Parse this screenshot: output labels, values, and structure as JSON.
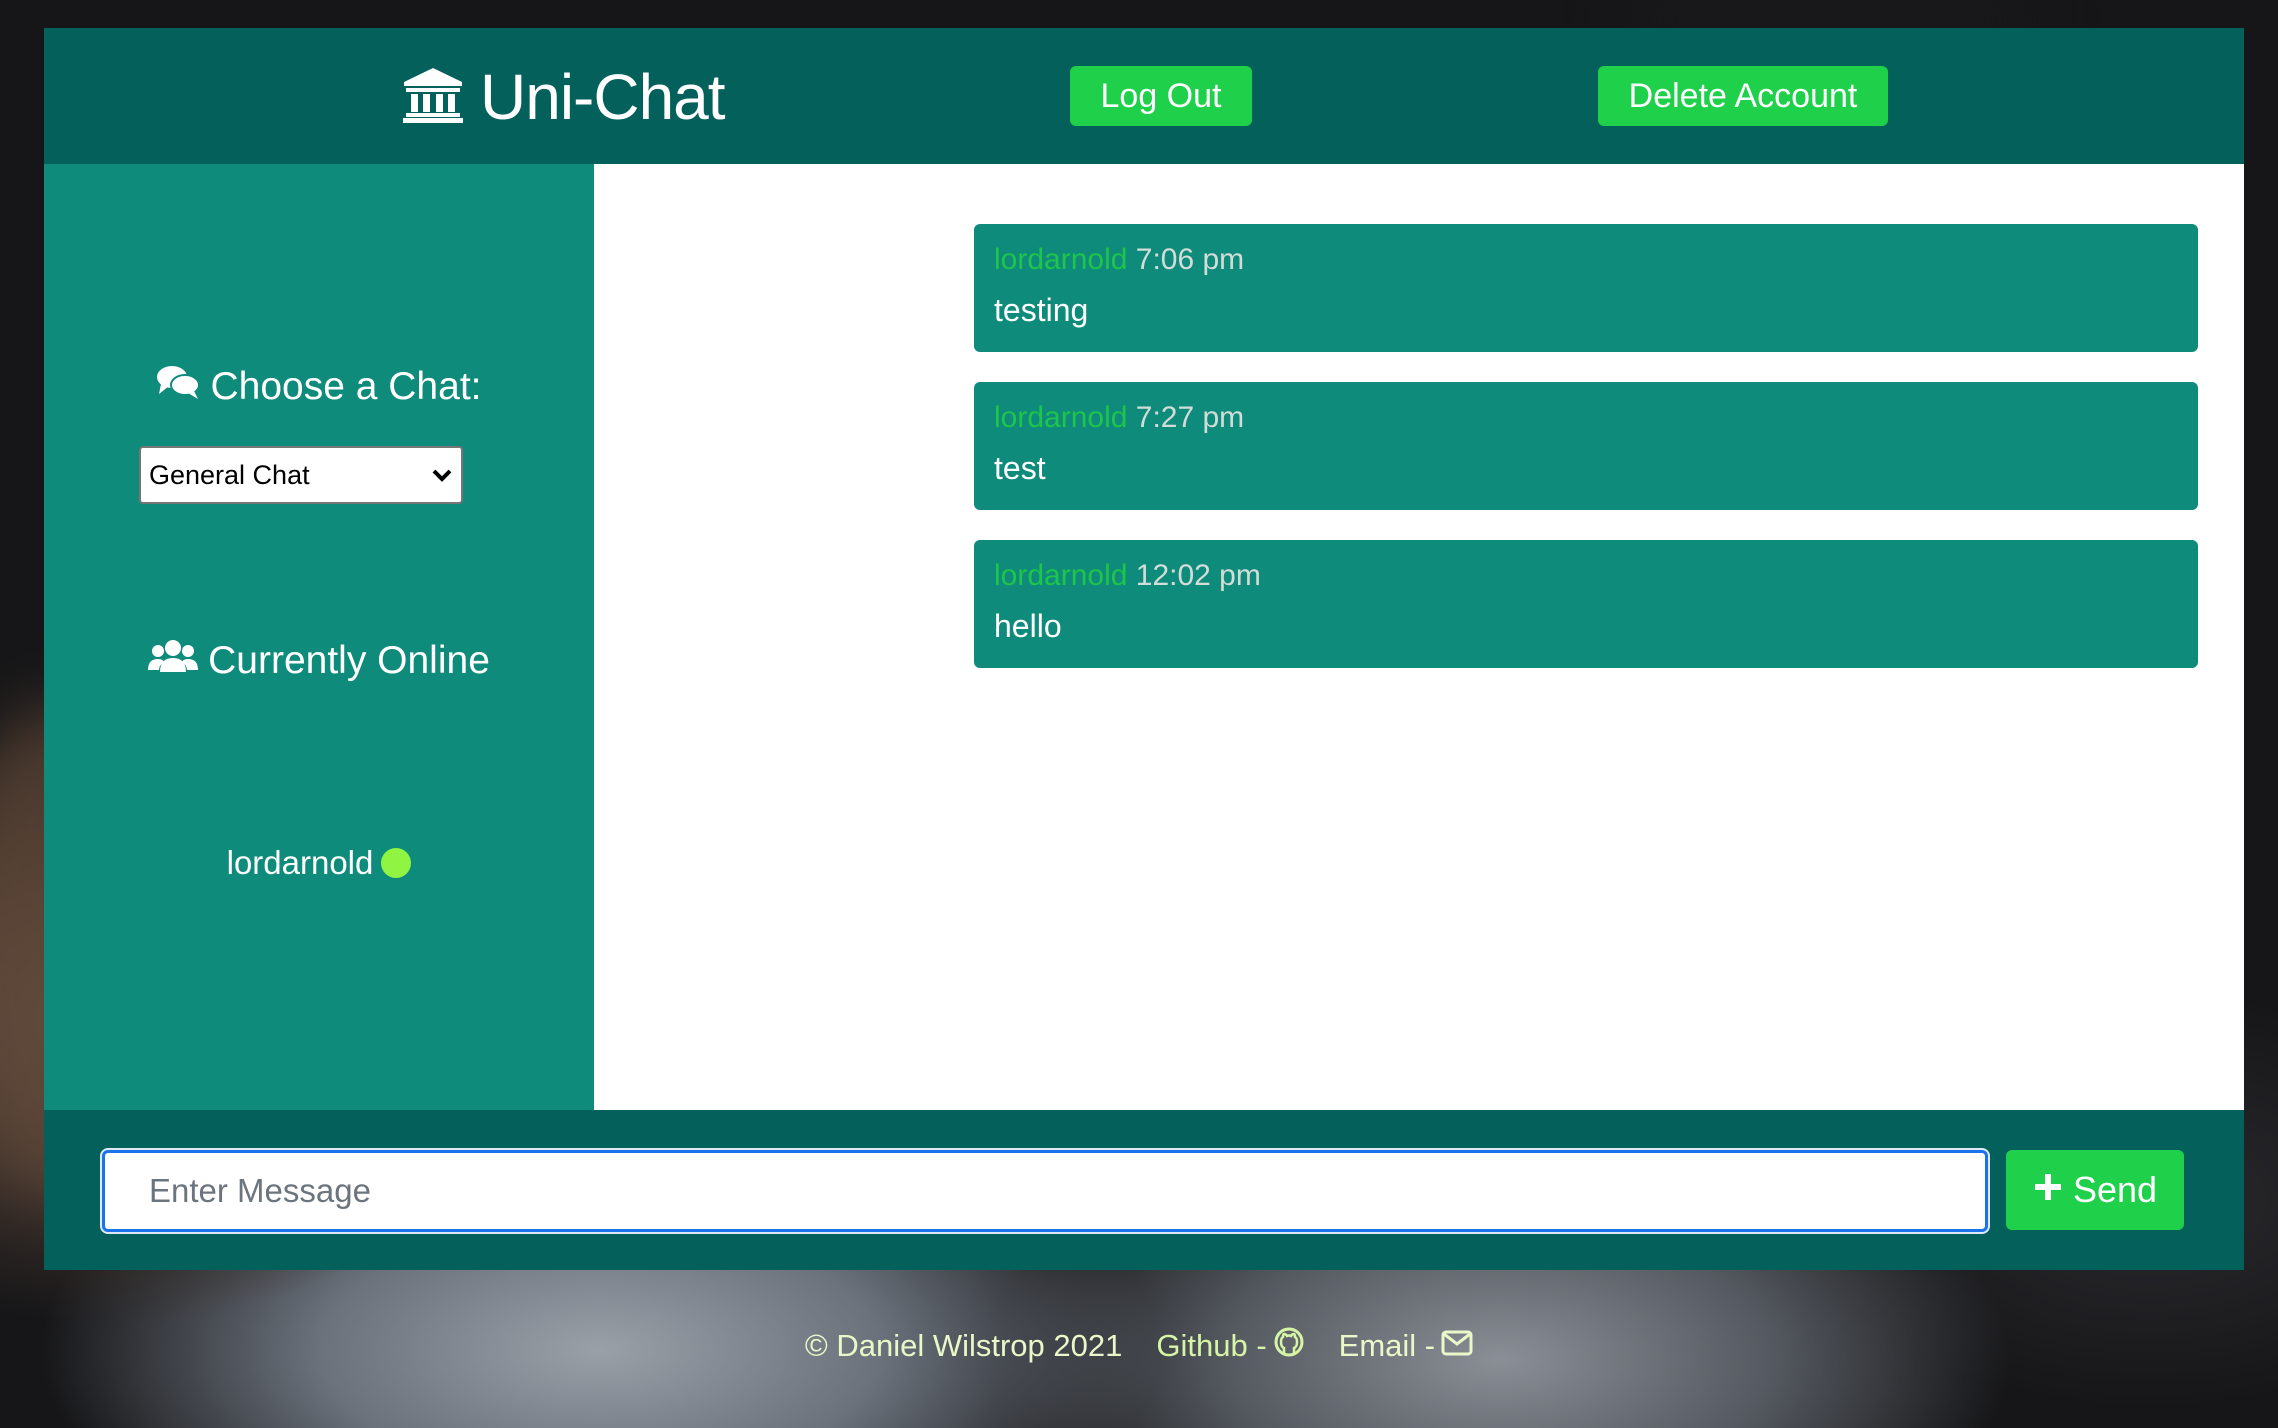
{
  "header": {
    "app_title": "Uni-Chat",
    "logo_icon": "university-icon",
    "logout_label": "Log Out",
    "delete_label": "Delete Account"
  },
  "sidebar": {
    "choose_heading": "Choose a Chat:",
    "choose_icon": "comments-icon",
    "chat_select_value": "General Chat",
    "online_heading": "Currently Online",
    "online_icon": "users-icon",
    "online_users": [
      {
        "name": "lordarnold",
        "status_color": "#8ff542"
      }
    ]
  },
  "messages": [
    {
      "user": "lordarnold",
      "time": "7:06 pm",
      "text": "testing"
    },
    {
      "user": "lordarnold",
      "time": "7:27 pm",
      "text": "test"
    },
    {
      "user": "lordarnold",
      "time": "12:02 pm",
      "text": "hello"
    }
  ],
  "composer": {
    "placeholder": "Enter Message",
    "value": "",
    "send_label": "Send",
    "send_icon": "plus-icon"
  },
  "footer": {
    "copyright": "© Daniel Wilstrop 2021",
    "github_label": "Github -",
    "github_icon": "github-icon",
    "email_label": "Email -",
    "email_icon": "envelope-icon"
  },
  "colors": {
    "header_bg": "#03605a",
    "sidebar_bg": "#0f8b7b",
    "accent_green": "#1fd14a",
    "username_green": "#1fc44a",
    "online_dot": "#8ff542"
  }
}
